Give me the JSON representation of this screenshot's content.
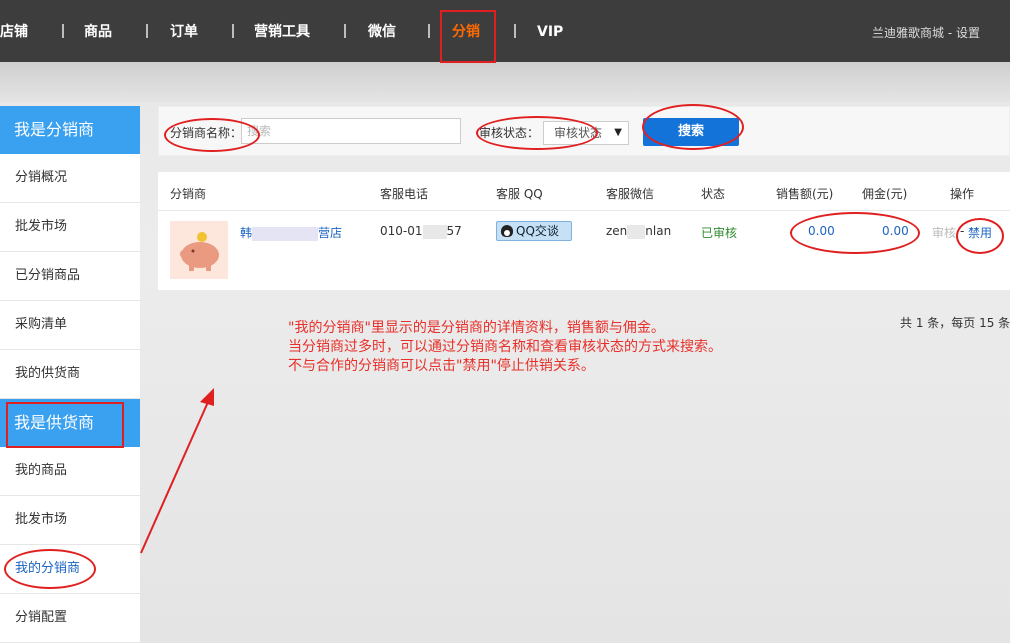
{
  "nav": {
    "items": [
      "店铺",
      "商品",
      "订单",
      "营销工具",
      "微信",
      "分销",
      "VIP"
    ],
    "active": "分销",
    "shop_link": "兰迪雅歌商城 - 设置"
  },
  "sidebar": {
    "section1": "我是分销商",
    "section1_items": [
      "分销概况",
      "批发市场",
      "已分销商品",
      "采购清单",
      "我的供货商"
    ],
    "section2": "我是供货商",
    "section2_items": [
      "我的商品",
      "批发市场",
      "我的分销商",
      "分销配置"
    ],
    "active_item": "我的分销商"
  },
  "search": {
    "name_label": "分销商名称：",
    "name_placeholder": "搜索",
    "status_label": "审核状态：",
    "status_value": "审核状态",
    "button": "搜索"
  },
  "table": {
    "headers": [
      "分销商",
      "客服电话",
      "客服 QQ",
      "客服微信",
      "状态",
      "销售额(元)",
      "佣金(元)",
      "操作"
    ],
    "rows": [
      {
        "name_start": "韩",
        "name_end": "营店",
        "phone_start": "010-01",
        "phone_end": "57",
        "qq_button": "QQ交谈",
        "wechat_start": "zen",
        "wechat_end": "nlan",
        "status": "已审核",
        "sales": "0.00",
        "commission": "0.00",
        "action_disabled": "审核",
        "action_sep": "-",
        "action": "禁用"
      }
    ]
  },
  "pager": "共 1 条，每页 15 条",
  "annotation": [
    "\"我的分销商\"里显示的是分销商的详情资料，销售额与佣金。",
    "当分销商过多时，可以通过分销商名称和查看审核状态的方式来搜索。",
    "不与合作的分销商可以点击\"禁用\"停止供销关系。"
  ],
  "colors": {
    "topbar": "#3d3d3d",
    "accent_orange": "#ff6a00",
    "sidebar_head": "#3aa0f0",
    "primary_button": "#1473d8",
    "status_green": "#2e8b2e",
    "link_blue": "#1b64c2",
    "annotation_red": "#e02020"
  }
}
